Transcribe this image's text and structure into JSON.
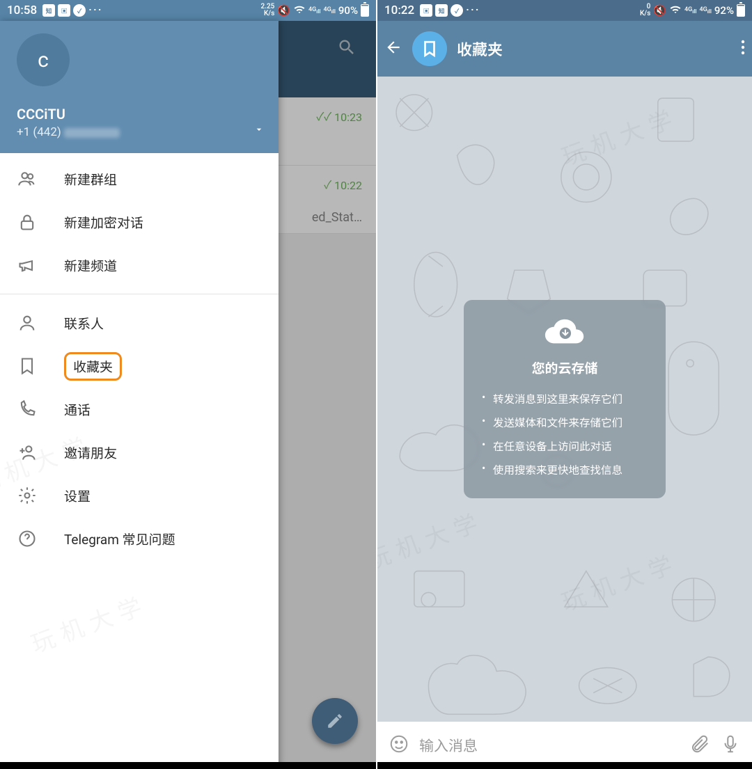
{
  "left": {
    "status": {
      "time": "10:58",
      "speed_top": "2.25",
      "speed_unit": "K/s",
      "battery": "90%"
    },
    "chat_bg": {
      "item1_time": "10:23",
      "item2_time": "10:22",
      "item2_snippet": "ed_Stat…"
    },
    "drawer": {
      "avatar_letter": "c",
      "name": "CCCiTU",
      "phone_prefix": "+1 (442)",
      "items": [
        {
          "label": "新建群组"
        },
        {
          "label": "新建加密对话"
        },
        {
          "label": "新建频道"
        },
        {
          "label": "联系人"
        },
        {
          "label": "收藏夹"
        },
        {
          "label": "通话"
        },
        {
          "label": "邀请朋友"
        },
        {
          "label": "设置"
        },
        {
          "label": "Telegram 常见问题"
        }
      ]
    }
  },
  "right": {
    "status": {
      "time": "10:22",
      "speed_top": "0",
      "speed_unit": "K/s",
      "battery": "92%"
    },
    "header": {
      "title": "收藏夹"
    },
    "cloud_card": {
      "heading": "您的云存储",
      "bullets": [
        "转发消息到这里来保存它们",
        "发送媒体和文件来存储它们",
        "在任意设备上访问此对话",
        "使用搜索来更快地查找信息"
      ]
    },
    "input": {
      "placeholder": "输入消息"
    }
  },
  "watermark": "玩机大学"
}
